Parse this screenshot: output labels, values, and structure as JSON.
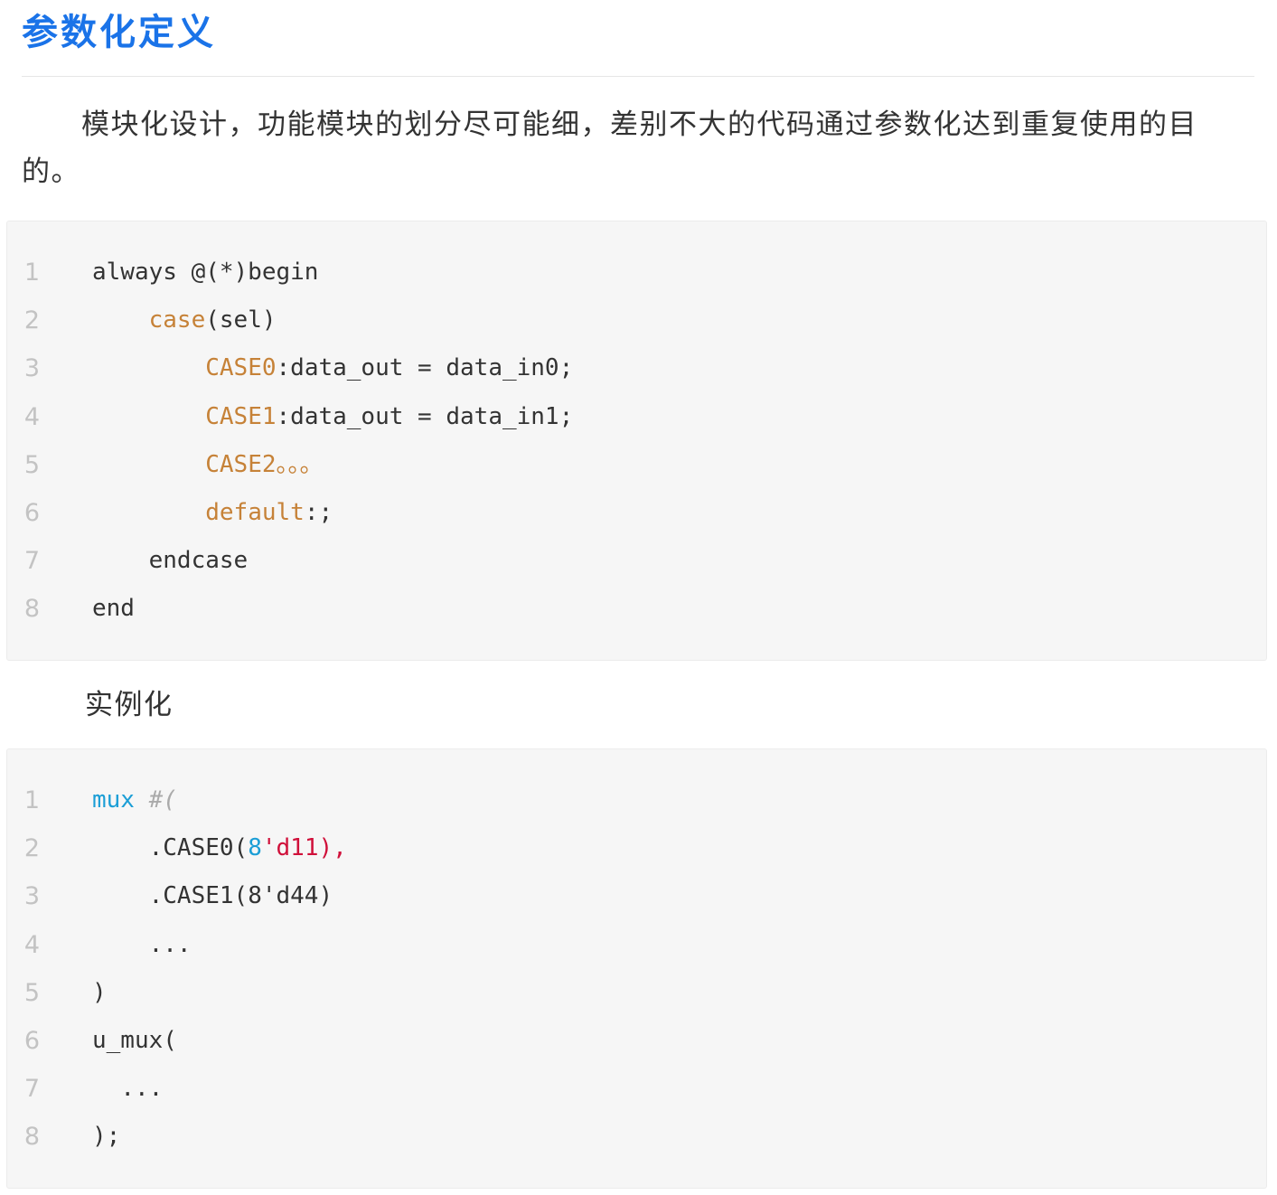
{
  "heading": "参数化定义",
  "intro_text": "模块化设计，功能模块的划分尽可能细，差别不大的代码通过参数化达到重复使用的目的。",
  "instantiation_label": "实例化",
  "code_block_1": {
    "line_numbers": [
      "1",
      "2",
      "3",
      "4",
      "5",
      "6",
      "7",
      "8"
    ],
    "lines": [
      {
        "indent": "",
        "segments": [
          {
            "text": "always @(*)begin",
            "cls": ""
          }
        ]
      },
      {
        "indent": "    ",
        "segments": [
          {
            "text": "case",
            "cls": "kw"
          },
          {
            "text": "(sel)",
            "cls": ""
          }
        ]
      },
      {
        "indent": "        ",
        "segments": [
          {
            "text": "CASE0",
            "cls": "kw"
          },
          {
            "text": ":data_out = data_in0;",
            "cls": ""
          }
        ]
      },
      {
        "indent": "        ",
        "segments": [
          {
            "text": "CASE1",
            "cls": "kw"
          },
          {
            "text": ":data_out = data_in1;",
            "cls": ""
          }
        ]
      },
      {
        "indent": "        ",
        "segments": [
          {
            "text": "CASE2。。。",
            "cls": "kw"
          }
        ]
      },
      {
        "indent": "        ",
        "segments": [
          {
            "text": "default",
            "cls": "kw"
          },
          {
            "text": ":;",
            "cls": ""
          }
        ]
      },
      {
        "indent": "    ",
        "segments": [
          {
            "text": "endcase",
            "cls": ""
          }
        ]
      },
      {
        "indent": "",
        "segments": [
          {
            "text": "end",
            "cls": ""
          }
        ]
      }
    ]
  },
  "code_block_2": {
    "line_numbers": [
      "1",
      "2",
      "3",
      "4",
      "5",
      "6",
      "7",
      "8"
    ],
    "lines": [
      {
        "indent": "",
        "segments": [
          {
            "text": "mux",
            "cls": "fn"
          },
          {
            "text": " #(",
            "cls": "cm"
          }
        ]
      },
      {
        "indent": "    ",
        "segments": [
          {
            "text": ".CASE0(",
            "cls": ""
          },
          {
            "text": "8",
            "cls": "num"
          },
          {
            "text": "'d11),",
            "cls": "str"
          }
        ]
      },
      {
        "indent": "    ",
        "segments": [
          {
            "text": ".CASE1(8'd44)",
            "cls": ""
          }
        ]
      },
      {
        "indent": "    ",
        "segments": [
          {
            "text": "...",
            "cls": ""
          }
        ]
      },
      {
        "indent": "",
        "segments": [
          {
            "text": ")",
            "cls": ""
          }
        ]
      },
      {
        "indent": "",
        "segments": [
          {
            "text": "u_mux(",
            "cls": ""
          }
        ]
      },
      {
        "indent": "  ",
        "segments": [
          {
            "text": "...",
            "cls": ""
          }
        ]
      },
      {
        "indent": "",
        "segments": [
          {
            "text": ");",
            "cls": ""
          }
        ]
      }
    ]
  },
  "colors": {
    "heading": "#1a73e8",
    "keyword": "#c68238",
    "function": "#1b9ed6",
    "comment": "#aaaaaa",
    "string": "#d0103a",
    "code_background": "#f6f6f6",
    "line_number": "#c3c3c3"
  }
}
